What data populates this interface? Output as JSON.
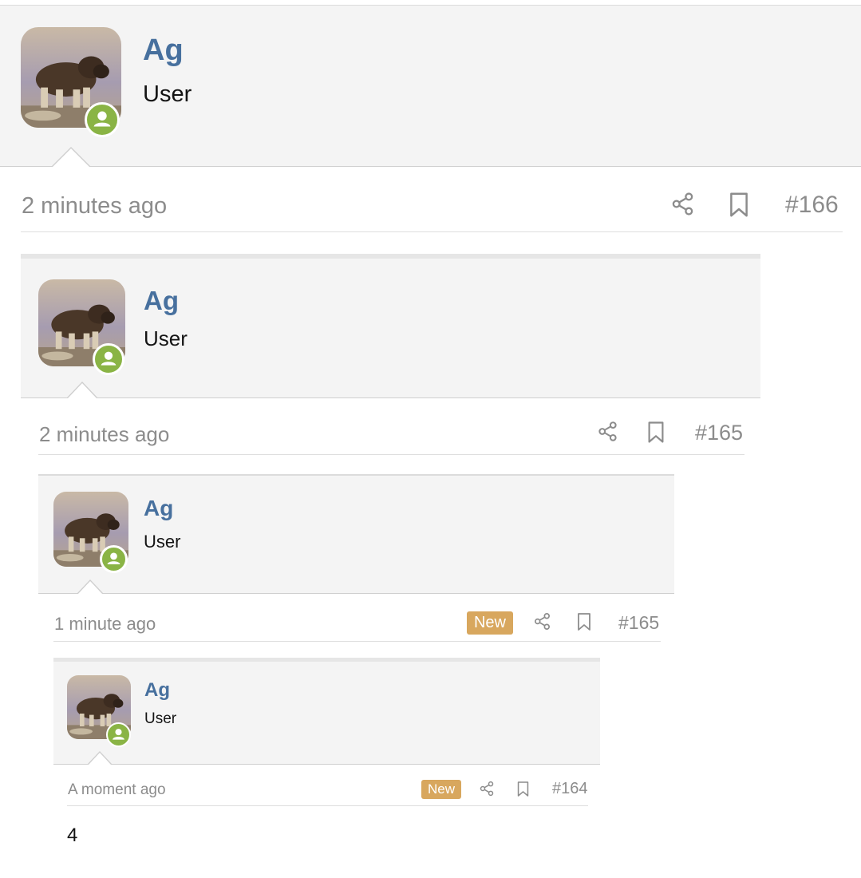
{
  "colors": {
    "username": "#47709e",
    "status_online": "#8ab445",
    "new_badge": "#d8a75e",
    "meta_text": "#8c8c8c",
    "panel_bg": "#f4f4f4"
  },
  "posts": [
    {
      "username": "Ag",
      "user_title": "User",
      "avatar_icon": "muskox-avatar",
      "status_icon": "online-user-icon",
      "time": "2 minutes ago",
      "share_icon": "share-icon",
      "bookmark_icon": "bookmark-icon",
      "post_number": "#166"
    },
    {
      "username": "Ag",
      "user_title": "User",
      "avatar_icon": "muskox-avatar",
      "status_icon": "online-user-icon",
      "time": "2 minutes ago",
      "share_icon": "share-icon",
      "bookmark_icon": "bookmark-icon",
      "post_number": "#165"
    },
    {
      "username": "Ag",
      "user_title": "User",
      "avatar_icon": "muskox-avatar",
      "status_icon": "online-user-icon",
      "time": "1 minute ago",
      "badge": "New",
      "share_icon": "share-icon",
      "bookmark_icon": "bookmark-icon",
      "post_number": "#165"
    },
    {
      "username": "Ag",
      "user_title": "User",
      "avatar_icon": "muskox-avatar",
      "status_icon": "online-user-icon",
      "time": "A moment ago",
      "badge": "New",
      "share_icon": "share-icon",
      "bookmark_icon": "bookmark-icon",
      "post_number": "#164",
      "body": "4"
    }
  ]
}
